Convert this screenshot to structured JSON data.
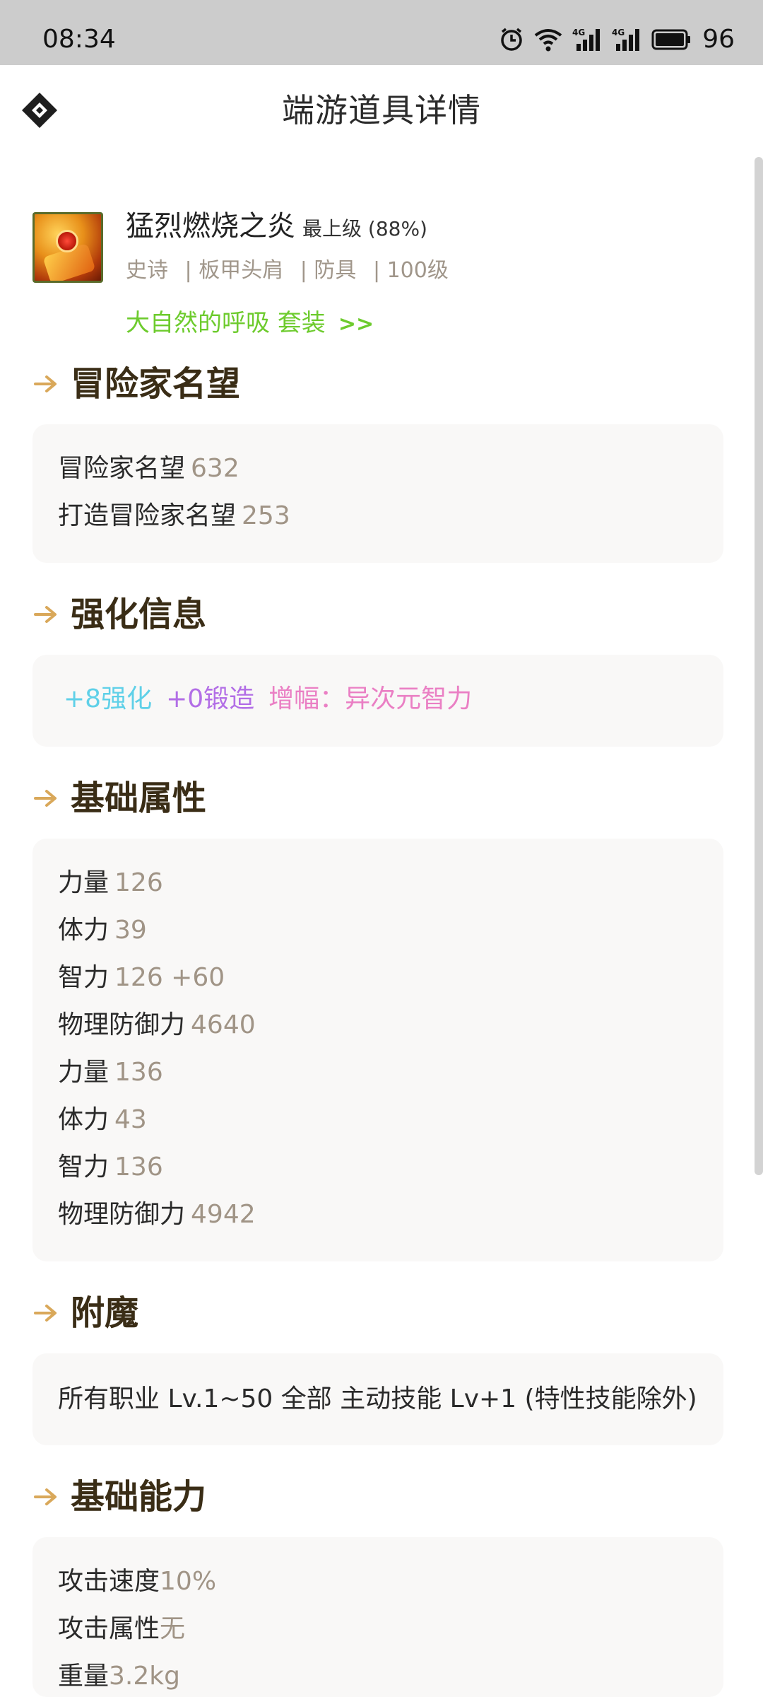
{
  "status_bar": {
    "time": "08:34",
    "battery": "96",
    "icons": [
      "alarm-icon",
      "wifi-icon",
      "signal-4g-icon",
      "signal-4g-icon",
      "battery-icon"
    ]
  },
  "header": {
    "title": "端游道具详情",
    "logo_icon": "diamond-logo-icon"
  },
  "item": {
    "name": "猛烈燃烧之炎",
    "grade": "最上级 (88%)",
    "meta": [
      "史诗",
      "| 板甲头肩",
      "| 防具",
      "| 100级"
    ],
    "set_link": "大自然的呼吸 套装",
    "set_arrow": ">>"
  },
  "sections": {
    "reputation": {
      "title": "冒险家名望",
      "rows": [
        {
          "label": "冒险家名望",
          "value": "632"
        },
        {
          "label": "打造冒险家名望",
          "value": "253"
        }
      ]
    },
    "enhance": {
      "title": "强化信息",
      "reinforce": "+8强化",
      "forge": "+0锻造",
      "amplify": "增幅：异次元智力"
    },
    "base_attrs": {
      "title": "基础属性",
      "rows": [
        {
          "label": "力量",
          "value": "126"
        },
        {
          "label": "体力",
          "value": "39"
        },
        {
          "label": "智力",
          "value": "126 +60"
        },
        {
          "label": "物理防御力",
          "value": "4640"
        },
        {
          "label": "力量",
          "value": "136"
        },
        {
          "label": "体力",
          "value": "43"
        },
        {
          "label": "智力",
          "value": "136"
        },
        {
          "label": "物理防御力",
          "value": "4942"
        }
      ]
    },
    "enchant": {
      "title": "附魔",
      "text": "所有职业 Lv.1~50 全部 主动技能 Lv+1 (特性技能除外)"
    },
    "base_ability": {
      "title": "基础能力",
      "rows": [
        {
          "label": "攻击速度",
          "value": "10%"
        },
        {
          "label": "攻击属性",
          "value": "无"
        },
        {
          "label": "重量",
          "value": "3.2kg"
        }
      ]
    }
  },
  "colors": {
    "section_title": "#3a2d16",
    "value_gray": "#a09486",
    "set_green": "#6dcb2d",
    "reinforce_cyan": "#5fd0e8",
    "forge_purple": "#b26ee6",
    "amplify_pink": "#ea7fc4",
    "arrow_gold": "#d9a85a"
  }
}
